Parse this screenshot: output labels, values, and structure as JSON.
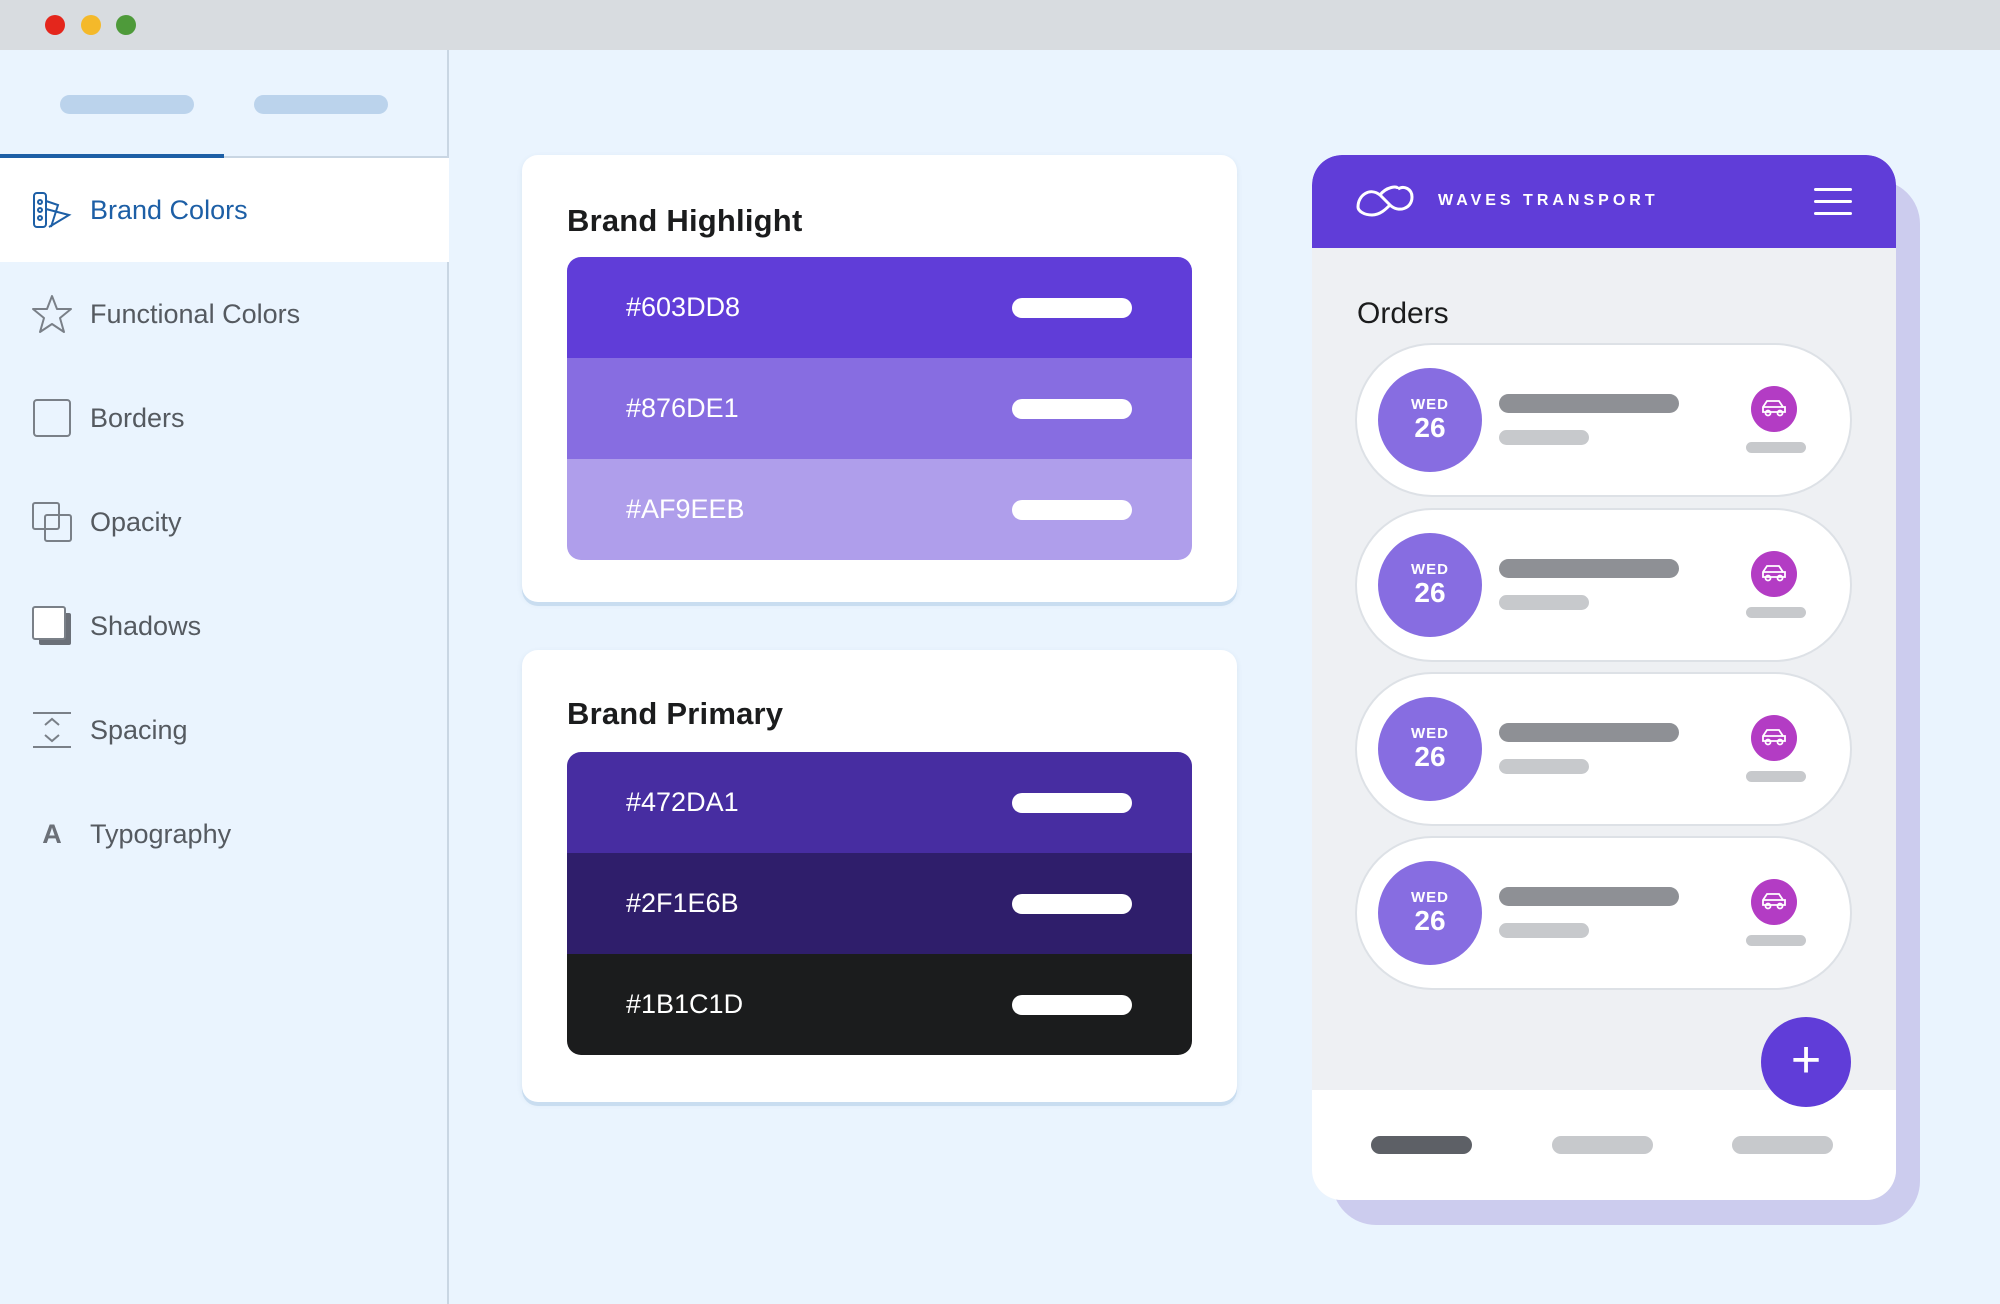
{
  "sidebar": {
    "items": [
      {
        "label": "Brand Colors",
        "icon": "palette-icon"
      },
      {
        "label": "Functional Colors",
        "icon": "star-icon"
      },
      {
        "label": "Borders",
        "icon": "square-icon"
      },
      {
        "label": "Opacity",
        "icon": "opacity-icon"
      },
      {
        "label": "Shadows",
        "icon": "shadow-icon"
      },
      {
        "label": "Spacing",
        "icon": "spacing-icon"
      },
      {
        "label": "Typography",
        "icon": "typography-icon"
      }
    ],
    "active_item": "Brand Colors",
    "typography_glyph": "A"
  },
  "brand_highlight": {
    "title": "Brand Highlight",
    "swatches": [
      {
        "hex": "#603DD8",
        "color": "#603DD8"
      },
      {
        "hex": "#876DE1",
        "color": "#876DE1"
      },
      {
        "hex": "#AF9EEB",
        "color": "#AF9EEB"
      }
    ]
  },
  "brand_primary": {
    "title": "Brand Primary",
    "swatches": [
      {
        "hex": "#472DA1",
        "color": "#472DA1"
      },
      {
        "hex": "#2F1E6B",
        "color": "#2F1E6B"
      },
      {
        "hex": "#1B1C1D",
        "color": "#1B1C1D"
      }
    ]
  },
  "phone": {
    "brand_name": "WAVES TRANSPORT",
    "header_color": "#603DD8",
    "orders_title": "Orders",
    "orders": [
      {
        "day": "WED",
        "date": "26"
      },
      {
        "day": "WED",
        "date": "26"
      },
      {
        "day": "WED",
        "date": "26"
      },
      {
        "day": "WED",
        "date": "26"
      }
    ],
    "fab_label": "+"
  },
  "colors": {
    "accent": "#1D5FA6",
    "background": "#EAF4FE"
  }
}
